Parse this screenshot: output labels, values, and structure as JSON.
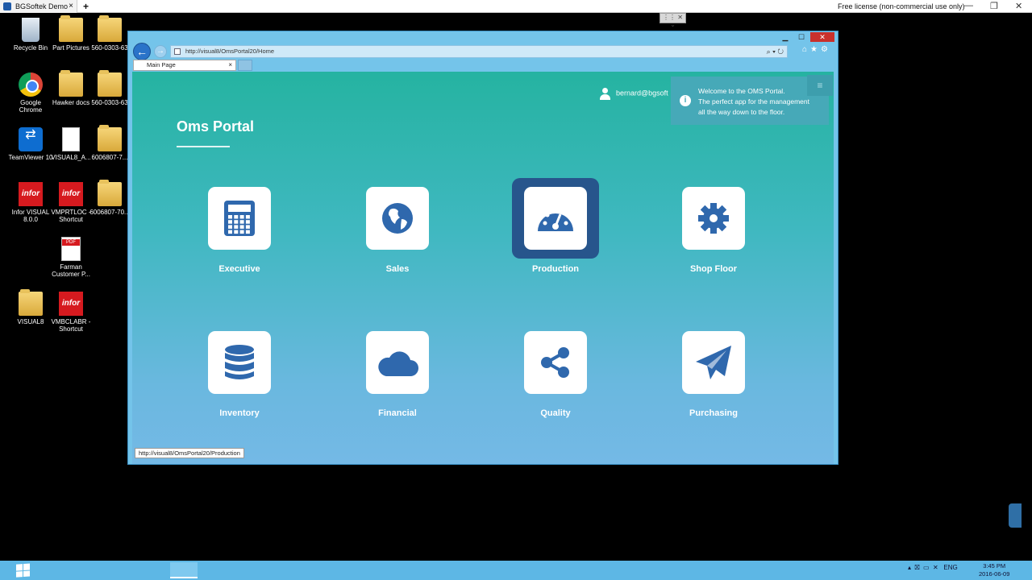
{
  "session": {
    "tab_title": "BGSoftek Demo",
    "license": "Free license (non-commercial use only)"
  },
  "desktop": {
    "icons": [
      {
        "label": "Recycle Bin",
        "icon": "recycle-bin-icon"
      },
      {
        "label": "Part Pictures",
        "icon": "folder-icon"
      },
      {
        "label": "560-0303-63",
        "icon": "folder-icon"
      },
      {
        "label": "Google Chrome",
        "icon": "chrome-icon"
      },
      {
        "label": "Hawker docs",
        "icon": "folder-icon"
      },
      {
        "label": "560-0303-63",
        "icon": "folder-icon"
      },
      {
        "label": "TeamViewer 10",
        "icon": "teamviewer-icon"
      },
      {
        "label": "VISUAL8_A...",
        "icon": "file-icon"
      },
      {
        "label": "6006807-7...",
        "icon": "folder-icon"
      },
      {
        "label": "Infor VISUAL 8.0.0",
        "icon": "infor-icon"
      },
      {
        "label": "VMPRTLOC - Shortcut",
        "icon": "infor-icon"
      },
      {
        "label": "6006807-70...",
        "icon": "folder-icon"
      },
      {
        "label": "Farman Customer P...",
        "icon": "pdf-icon"
      },
      {
        "label": "VISUAL8",
        "icon": "folder-icon"
      },
      {
        "label": "VMBCLABR - Shortcut",
        "icon": "infor-icon"
      }
    ]
  },
  "browser": {
    "url": "http://visual8/OmsPortal20/Home",
    "tab_label": "Main Page",
    "status_url": "http://visual8/OmsPortal20/Production"
  },
  "portal": {
    "title": "Oms Portal",
    "user": "bernard@bgsoft",
    "toast_lines": [
      "Welcome to the OMS Portal.",
      "The perfect app for the management",
      "all the way down to the floor."
    ],
    "tiles": [
      {
        "label": "Executive",
        "icon": "calculator-icon"
      },
      {
        "label": "Sales",
        "icon": "globe-icon"
      },
      {
        "label": "Production",
        "icon": "dashboard-gauge-icon",
        "active": true
      },
      {
        "label": "Shop Floor",
        "icon": "gear-icon"
      },
      {
        "label": "Inventory",
        "icon": "database-icon"
      },
      {
        "label": "Financial",
        "icon": "cloud-icon"
      },
      {
        "label": "Quality",
        "icon": "share-icon"
      },
      {
        "label": "Purchasing",
        "icon": "paper-plane-icon"
      }
    ]
  },
  "taskbar": {
    "lang": "ENG",
    "time": "3:45 PM",
    "date": "2016-06-09"
  },
  "colors": {
    "icon_blue": "#2f68ad",
    "active_tile": "#27558c",
    "teal_top": "#25b3a1",
    "blue_bottom": "#74b9e6"
  }
}
